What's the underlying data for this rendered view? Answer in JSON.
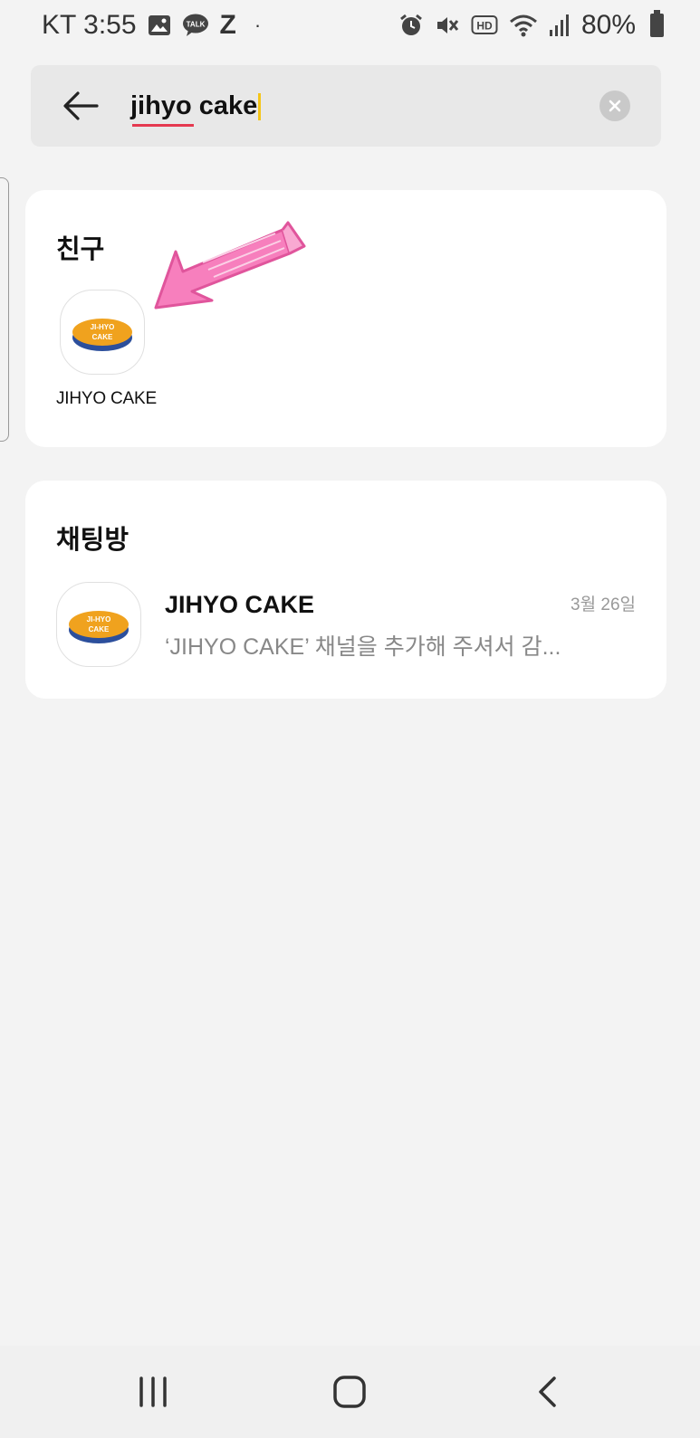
{
  "status_bar": {
    "carrier_time": "KT 3:55",
    "talk_badge": "TALK",
    "z_label": "Z",
    "dot": "·",
    "hd_badge": "HD",
    "battery": "80%",
    "icons": [
      "gallery-icon",
      "kakaotalk-icon",
      "alarm-icon",
      "mute-icon",
      "hd-voice-icon",
      "wifi-icon",
      "signal-icon",
      "battery-icon"
    ]
  },
  "search": {
    "query_word1": "jihyo",
    "query_rest": " cake",
    "icons": [
      "back-arrow-icon",
      "clear-icon"
    ]
  },
  "friends": {
    "title": "친구",
    "items": [
      {
        "name": "JIHYO CAKE",
        "logo_text_top": "JI-HYO",
        "logo_text_bottom": "CAKE"
      }
    ]
  },
  "chats": {
    "title": "채팅방",
    "items": [
      {
        "title": "JIHYO CAKE",
        "preview": "‘JIHYO CAKE’ 채널을 추가해 주셔서 감...",
        "date": "3월 26일",
        "logo_text_top": "JI-HYO",
        "logo_text_bottom": "CAKE"
      }
    ]
  },
  "colors": {
    "background": "#f3f3f3",
    "card": "#ffffff",
    "search_bg": "#e8e8e8",
    "arrow_pink": "#f77fbd",
    "logo_orange": "#f0a21e",
    "logo_blue": "#2c4f9c"
  },
  "nav": {
    "icons": [
      "recent-apps-icon",
      "home-icon",
      "back-icon"
    ]
  }
}
